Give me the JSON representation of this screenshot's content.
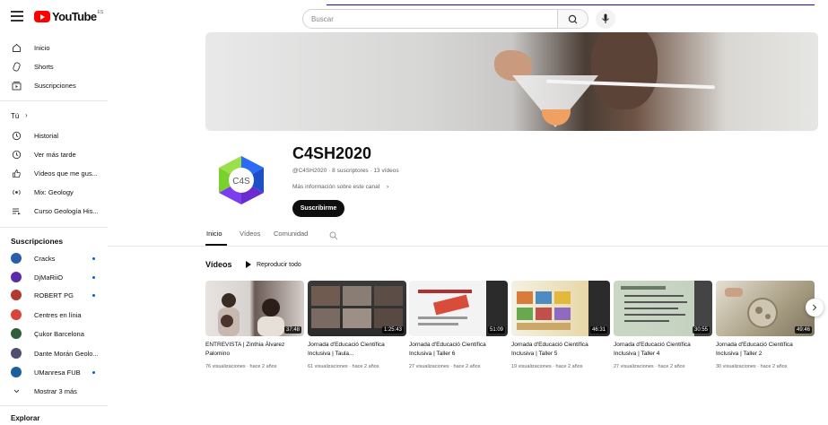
{
  "header": {
    "logo_text": "YouTube",
    "logo_country": "ES",
    "search_placeholder": "Buscar"
  },
  "sidebar": {
    "main": [
      {
        "label": "Inicio",
        "icon": "home-icon"
      },
      {
        "label": "Shorts",
        "icon": "shorts-icon"
      },
      {
        "label": "Suscripciones",
        "icon": "subscriptions-icon"
      }
    ],
    "you_label": "Tú",
    "you": [
      {
        "label": "Historial",
        "icon": "history-icon"
      },
      {
        "label": "Ver más tarde",
        "icon": "watch-later-icon"
      },
      {
        "label": "Vídeos que me gus...",
        "icon": "thumbs-up-icon"
      },
      {
        "label": "Mix: Geology",
        "icon": "mix-icon"
      },
      {
        "label": "Curso Geología His...",
        "icon": "playlist-icon"
      }
    ],
    "subscriptions_label": "Suscripciones",
    "subscriptions": [
      {
        "label": "Cracks",
        "color": "#2c5ea8",
        "dot": true
      },
      {
        "label": "DjMaRiiO",
        "color": "#5a2ca8",
        "dot": true
      },
      {
        "label": "ROBERT PG",
        "color": "#b03a2e",
        "dot": true
      },
      {
        "label": "Centres en línia",
        "color": "#d9443a",
        "dot": false
      },
      {
        "label": "Çukor Barcelona",
        "color": "#2e5e3a",
        "dot": false
      },
      {
        "label": "Dante Morán Geolo...",
        "color": "#4f4f6f",
        "dot": false
      },
      {
        "label": "UManresa FUB",
        "color": "#1d5f9c",
        "dot": true
      }
    ],
    "show_more": "Mostrar 3 más",
    "explore_label": "Explorar"
  },
  "channel": {
    "logo_text": "C4S",
    "name": "C4SH2020",
    "meta": "@C4SH2020 · 8 suscriptores · 13 vídeos",
    "more_info": "Más información sobre este canal",
    "subscribe": "Suscribirme"
  },
  "tabs": [
    {
      "label": "Inicio",
      "active": true
    },
    {
      "label": "Vídeos",
      "active": false
    },
    {
      "label": "Comunidad",
      "active": false
    }
  ],
  "videos_section": {
    "title": "Vídeos",
    "play_all": "Reproducir todo",
    "items": [
      {
        "title": "ENTREVISTA | Zinthia Álvarez Palomino",
        "duration": "37:48",
        "meta": "76 visualizaciones · hace 2 años"
      },
      {
        "title": "Jornada d'Educació Científica Inclusiva | Taula...",
        "duration": "1:25:43",
        "meta": "61 visualizaciones · hace 2 años"
      },
      {
        "title": "Jornada d'Educació Científica Inclusiva | Taller 6",
        "duration": "51:09",
        "meta": "27 visualizaciones · hace 2 años"
      },
      {
        "title": "Jornada d'Educació Científica Inclusiva | Taller 5",
        "duration": "46:31",
        "meta": "19 visualizaciones · hace 2 años"
      },
      {
        "title": "Jornada d'Educació Científica Inclusiva | Taller 4",
        "duration": "30:55",
        "meta": "27 visualizaciones · hace 2 años"
      },
      {
        "title": "Jornada d'Educació Científica Inclusiva | Taller 2",
        "duration": "49:46",
        "meta": "30 visualizaciones · hace 2 años"
      }
    ]
  }
}
